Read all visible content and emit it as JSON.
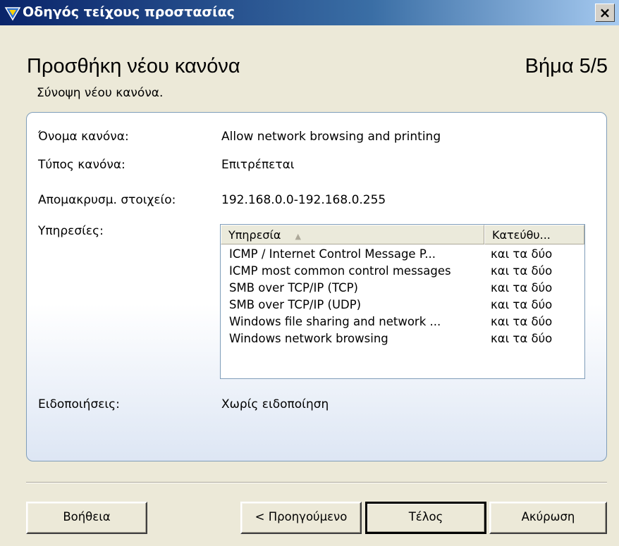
{
  "window": {
    "title": "Οδηγός τείχους προστασίας",
    "close_label": "×"
  },
  "header": {
    "title": "Προσθήκη νέου κανόνα",
    "step": "Βήμα 5/5",
    "subtitle": "Σύνοψη νέου κανόνα."
  },
  "summary": {
    "rule_name_label": "Όνομα κανόνα:",
    "rule_name_value": "Allow network browsing and printing",
    "rule_type_label": "Τύπος κανόνα:",
    "rule_type_value": "Επιτρέπεται",
    "remote_item_label": "Απομακρυσμ. στοιχείο:",
    "remote_item_value": "192.168.0.0-192.168.0.255",
    "services_label": "Υπηρεσίες:",
    "notifications_label": "Ειδοποιήσεις:",
    "notifications_value": "Χωρίς ειδοποίηση"
  },
  "services_table": {
    "columns": [
      "Υπηρεσία",
      "Κατεύθυ..."
    ],
    "sort_indicator": "▲",
    "rows": [
      [
        "ICMP / Internet Control Message P...",
        "και τα δύο"
      ],
      [
        "ICMP most common control messages",
        "και τα δύο"
      ],
      [
        "SMB over TCP/IP (TCP)",
        "και τα δύο"
      ],
      [
        "SMB over TCP/IP (UDP)",
        "και τα δύο"
      ],
      [
        "Windows file sharing and network ...",
        "και τα δύο"
      ],
      [
        "Windows network browsing",
        "και τα δύο"
      ]
    ]
  },
  "buttons": {
    "help": "Βοήθεια",
    "back": "< Προηγούμενο",
    "finish": "Τέλος",
    "cancel": "Ακύρωση"
  },
  "colors": {
    "title_bar": "#0a246a",
    "dialog_bg": "#ece9d8",
    "box_border": "#7f9db9"
  }
}
